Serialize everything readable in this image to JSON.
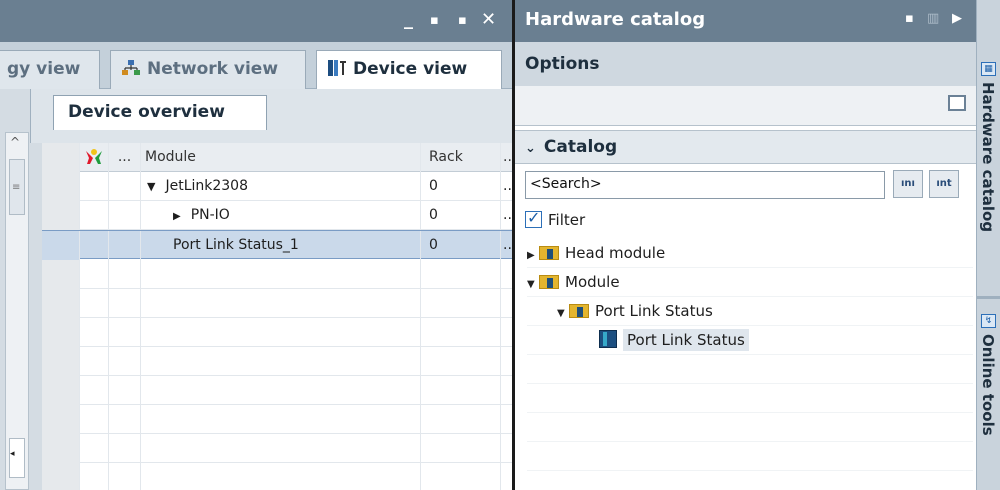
{
  "left_pane": {
    "window_controls": [
      "_",
      "▪",
      "▪",
      "✕"
    ],
    "tabs": [
      {
        "label": "gy view",
        "active": false
      },
      {
        "label": "Network view",
        "active": false
      },
      {
        "label": "Device view",
        "active": true
      }
    ],
    "sub_tab": "Device overview",
    "table": {
      "columns": [
        "",
        "",
        "...",
        "Module",
        "Rack",
        "..."
      ],
      "rows": [
        {
          "module": "JetLink2308",
          "rack": "0",
          "expand": "▼",
          "indent": 0,
          "selected": false
        },
        {
          "module": "PN-IO",
          "rack": "0",
          "expand": "▶",
          "indent": 1,
          "selected": false
        },
        {
          "module": "Port Link Status_1",
          "rack": "0",
          "expand": "",
          "indent": 0,
          "selected": true
        }
      ]
    }
  },
  "right_pane": {
    "title": "Hardware catalog",
    "options_label": "Options",
    "catalog_label": "Catalog",
    "search_value": "<Search>",
    "search_buttons": [
      "ını",
      "ınt"
    ],
    "filter_label": "Filter",
    "filter_checked": true,
    "tree": [
      {
        "label": "Head module",
        "expand": "▶",
        "icon": "folder",
        "level": 0
      },
      {
        "label": "Module",
        "expand": "▼",
        "icon": "folder",
        "level": 0
      },
      {
        "label": "Port Link Status",
        "expand": "▼",
        "icon": "folder",
        "level": 1
      },
      {
        "label": "Port Link Status",
        "expand": "",
        "icon": "module",
        "level": 2,
        "highlighted": true
      }
    ]
  },
  "side_strip": {
    "tab1": "Hardware catalog",
    "tab2": "Online tools"
  },
  "colors": {
    "titlebar": "#6a7f91",
    "selection": "#cad9ea",
    "folder": "#e3b52f"
  }
}
